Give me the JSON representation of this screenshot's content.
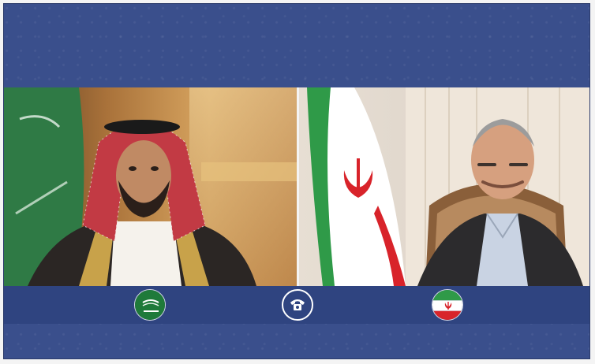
{
  "colors": {
    "frame_bg": "#3a4f8c",
    "bar_bg": "#2f4480",
    "saudi_green": "#1f7a3a",
    "iran_green": "#2f9a48",
    "iran_red": "#d8232a",
    "white": "#ffffff"
  },
  "icons": {
    "left_flag": "saudi-flag-icon",
    "center": "telephone-icon",
    "right_flag": "iran-flag-icon"
  }
}
